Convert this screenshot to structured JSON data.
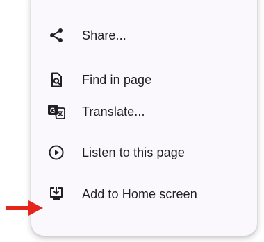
{
  "menu": {
    "items": [
      {
        "label": "Share...",
        "icon": "share-icon"
      },
      {
        "label": "Find in page",
        "icon": "find-in-page-icon"
      },
      {
        "label": "Translate...",
        "icon": "translate-icon"
      },
      {
        "label": "Listen to this page",
        "icon": "play-circle-icon"
      },
      {
        "label": "Add to Home screen",
        "icon": "add-to-home-screen-icon"
      }
    ]
  },
  "colors": {
    "menu_background": "#fbf8fd",
    "text": "#1f1f24",
    "icon": "#1f1f24",
    "annotation_arrow": "#e5241b"
  }
}
